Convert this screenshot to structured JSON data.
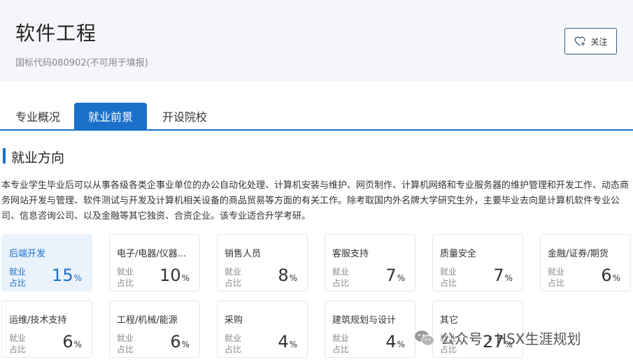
{
  "header": {
    "title": "软件工程",
    "subtitle": "国标代码080902(不可用于填报)",
    "follow_label": "关注"
  },
  "tabs": [
    {
      "label": "专业概况",
      "active": false
    },
    {
      "label": "就业前景",
      "active": true
    },
    {
      "label": "开设院校",
      "active": false
    }
  ],
  "section": {
    "title": "就业方向",
    "description": "本专业学生毕业后可以从事各级各类企事业单位的办公自动化处理、计算机安装与维护、网页制作、计算机网络和专业服务器的维护管理和开发工作、动态商务网站开发与管理、软件测试与开发及计算机相关设备的商品贸易等方面的有关工作。除考取国内外名牌大学研究生外，主要毕业去向是计算机软件专业公司、信息咨询公司、以及金融等其它独资、合资企业。该专业适合升学考研。"
  },
  "card_label": "就业占比",
  "pct_unit": "%",
  "cards": [
    {
      "name": "后端开发",
      "value": "15"
    },
    {
      "name": "电子/电器/仪器...",
      "value": "10"
    },
    {
      "name": "销售人员",
      "value": "8"
    },
    {
      "name": "客服支持",
      "value": "7"
    },
    {
      "name": "质量安全",
      "value": "7"
    },
    {
      "name": "金融/证券/期货",
      "value": "6"
    },
    {
      "name": "运维/技术支持",
      "value": "6"
    },
    {
      "name": "工程/机械/能源",
      "value": "6"
    },
    {
      "name": "采购",
      "value": "4"
    },
    {
      "name": "建筑规划与设计",
      "value": "4"
    },
    {
      "name": "其它",
      "value": "27"
    }
  ],
  "watermark": {
    "text": "公众号 · HSX生涯规划"
  },
  "colors": {
    "accent": "#1a6fc9",
    "highlight_bg": "#eaf2fc"
  }
}
